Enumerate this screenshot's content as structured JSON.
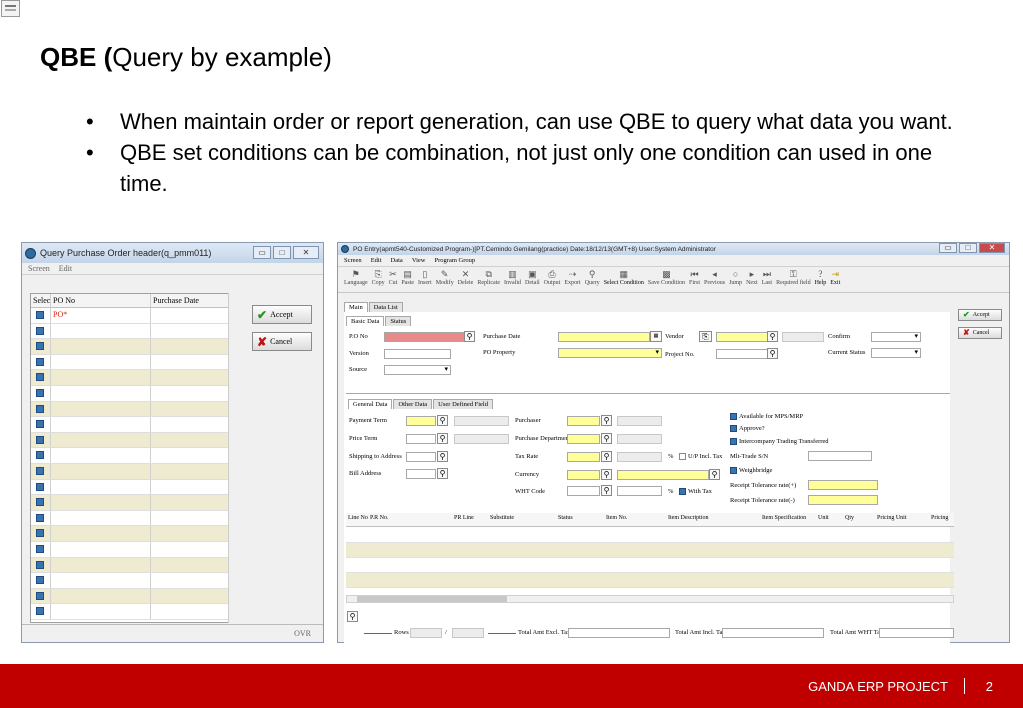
{
  "slide": {
    "title_bold": "QBE (",
    "title_rest": "Query by example)",
    "bullets": [
      "When maintain order or report generation, can use QBE to query what data you want.",
      "QBE set conditions can be combination, not just only one condition can used in one time."
    ],
    "footer_text": "GANDA ERP PROJECT",
    "page_number": "2",
    "footer_color": "#c00000"
  },
  "query_window": {
    "title": "Query Purchase Order header(q_pmm011)",
    "menu": [
      "Screen",
      "Edit"
    ],
    "columns": [
      "Selec",
      "PO No",
      "Purchase Date"
    ],
    "first_value": "PO*",
    "accept": "Accept",
    "cancel": "Cancel",
    "status": "OVR"
  },
  "po_window": {
    "title": "PO Entry(apmt540-Customized Program-)[PT.Cemindo Gemilang(practice)  Date:18/12/13(GMT+8)  User:System Administrator",
    "menu": [
      "Screen",
      "Edit",
      "Data",
      "View",
      "Program Group"
    ],
    "toolbar": [
      "Language",
      "Copy",
      "Cut",
      "Paste",
      "Insert",
      "Modify",
      "Delete",
      "Replicate",
      "Invalid",
      "Detail",
      "Output",
      "Export",
      "Query",
      "Select Condition",
      "Save Condition",
      "First",
      "Previous",
      "Jump",
      "Next",
      "Last",
      "Required field",
      "Help",
      "Exit"
    ],
    "top_tabs": [
      "Main",
      "Data List"
    ],
    "sub_tabs": [
      "Basic Data",
      "Status"
    ],
    "basic": {
      "po_no": "P.O No",
      "version": "Version",
      "source": "Source",
      "purchase_date": "Purchase Date",
      "po_property": "PO Property",
      "vendor": "Vendor",
      "project_no": "Project No.",
      "confirm": "Confirm",
      "current_status": "Current Status"
    },
    "detail_tabs": [
      "General Data",
      "Other Data",
      "User Defined Field"
    ],
    "general": {
      "payment_term": "Payment Term",
      "price_term": "Price Term",
      "shipping_address": "Shipping to Address",
      "bill_address": "Bill Address",
      "purchaser": "Purchaser",
      "purchase_department": "Purchase Department",
      "tax_rate": "Tax Rate",
      "currency": "Currency",
      "wht_code": "WHT Code",
      "up_incl_tax": "U/P Incl. Tax",
      "with_tax": "With Tax",
      "available_mps": "Available for MPS/MRP",
      "approve": "Approve?",
      "intercompany": "Intercompany Trading Transferred",
      "mlt_trade": "Mlt-Trade S/N",
      "weighbridge": "Weighbridge",
      "tol_plus": "Receipt Tolerance rate(+)",
      "tol_minus": "Receipt Tolerance rate(-)"
    },
    "grid_columns": [
      "Line No",
      "P.R No.",
      "PR Line",
      "Substitute",
      "Status",
      "Item No.",
      "Item Description",
      "Item Specification",
      "Unit",
      "Qty",
      "Pricing Unit",
      "Pricing"
    ],
    "totals": {
      "rows": "Rows",
      "slash": "/",
      "excl": "Total Amt Excl. Tax",
      "incl": "Total Amt Incl. Tax",
      "wht": "Total Amt WHT Tax"
    },
    "accept": "Accept",
    "cancel": "Cancel"
  }
}
